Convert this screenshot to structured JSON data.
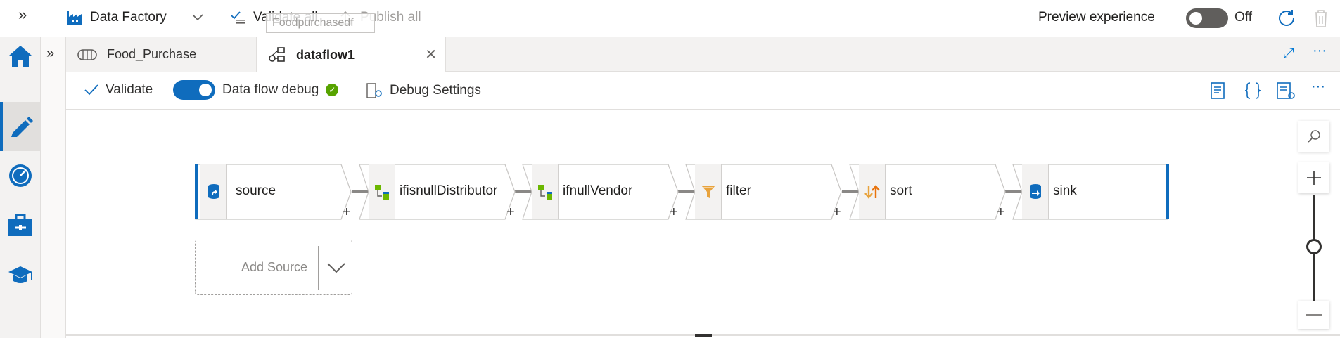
{
  "topbar": {
    "factory_name": "Data Factory",
    "validate_all": "Validate all",
    "publish_all": "Publish all",
    "ghost_tooltip": "Foodpurchasedf",
    "preview_label": "Preview experience",
    "preview_state": "Off"
  },
  "tabs": [
    {
      "label": "Food_Purchase",
      "icon": "pipeline-icon"
    },
    {
      "label": "dataflow1",
      "icon": "dataflow-icon",
      "active": true
    }
  ],
  "toolbar": {
    "validate": "Validate",
    "debug_label": "Data flow debug",
    "debug_settings": "Debug Settings"
  },
  "nodes": [
    {
      "label": "source",
      "icon": "source-icon"
    },
    {
      "label": "ifisnullDistributor",
      "icon": "derived-column-icon"
    },
    {
      "label": "ifnullVendor",
      "icon": "derived-column-icon"
    },
    {
      "label": "filter",
      "icon": "filter-icon"
    },
    {
      "label": "sort",
      "icon": "sort-icon"
    },
    {
      "label": "sink",
      "icon": "sink-icon"
    }
  ],
  "add_source": "Add Source",
  "plus": "+",
  "colors": {
    "accent": "#0f6cbd",
    "success": "#57a300",
    "filter": "#e8a33d",
    "sort": "#e8730c"
  }
}
